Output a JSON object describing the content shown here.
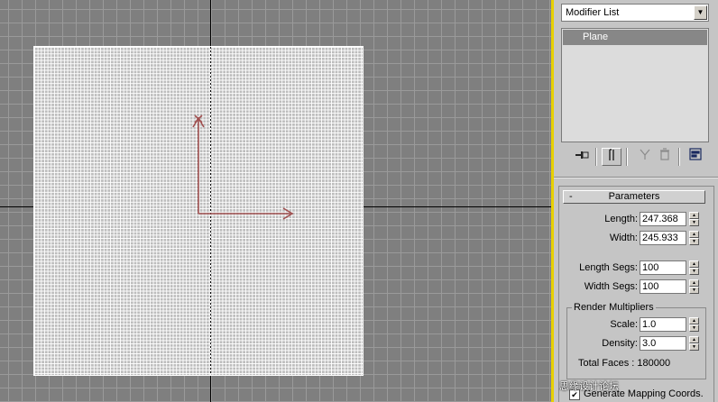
{
  "command_panel": {
    "modifier_list": {
      "selected": "Modifier List"
    },
    "stack": {
      "items": [
        "Plane"
      ]
    },
    "toolbar": {
      "icons": [
        "pin-stack-icon",
        "show-end-result-icon",
        "make-unique-icon",
        "remove-modifier-icon",
        "configure-modifier-sets-icon"
      ]
    }
  },
  "parameters": {
    "header": "Parameters",
    "collapse_symbol": "-",
    "length_label": "Length:",
    "length_value": "247.368",
    "width_label": "Width:",
    "width_value": "245.933",
    "length_segs_label": "Length Segs:",
    "length_segs_value": "100",
    "width_segs_label": "Width Segs:",
    "width_segs_value": "100",
    "render_multipliers": {
      "label": "Render Multipliers",
      "scale_label": "Scale:",
      "scale_value": "1.0",
      "density_label": "Density:",
      "density_value": "3.0",
      "total_faces": "Total Faces : 180000"
    },
    "generate_mapping": {
      "label": "Generate Mapping Coords.",
      "checked": true
    }
  },
  "viewport": {
    "gizmo_color": "#a05050",
    "selection_color": "#e8d000"
  },
  "watermark": "思缘设计论坛"
}
